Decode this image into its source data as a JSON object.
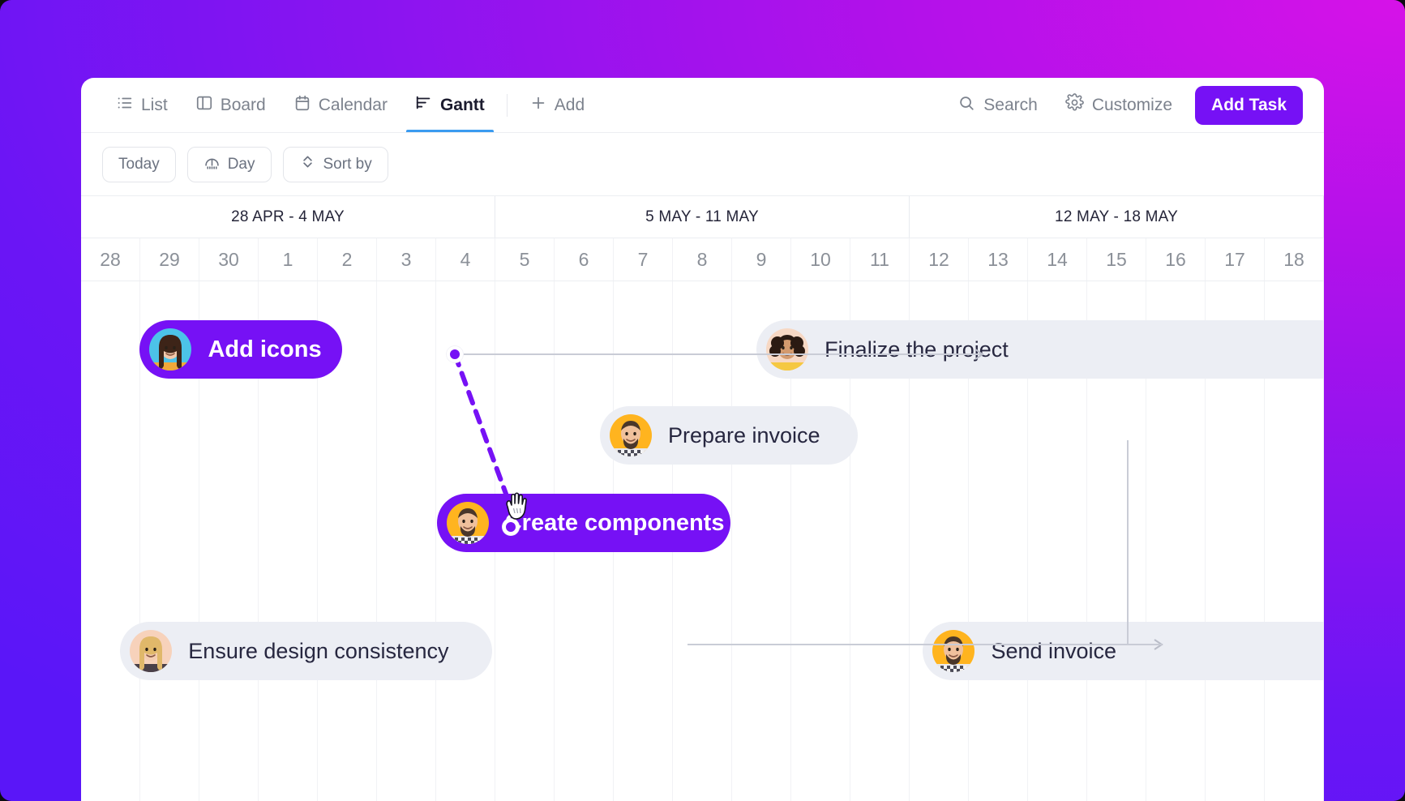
{
  "app": {
    "accent_purple": "#7611f5",
    "accent_blue": "#3b9bf0",
    "bar_ghost_bg": "#eceef4"
  },
  "viewbar": {
    "tabs": [
      {
        "id": "list",
        "label": "List",
        "icon": "list-icon",
        "active": false
      },
      {
        "id": "board",
        "label": "Board",
        "icon": "board-icon",
        "active": false
      },
      {
        "id": "calendar",
        "label": "Calendar",
        "icon": "calendar-icon",
        "active": false
      },
      {
        "id": "gantt",
        "label": "Gantt",
        "icon": "gantt-icon",
        "active": true
      }
    ],
    "add_label": "Add",
    "add_icon": "plus-icon",
    "search_label": "Search",
    "search_icon": "search-icon",
    "customize_label": "Customize",
    "customize_icon": "gear-icon",
    "add_task_label": "Add Task"
  },
  "filterbar": {
    "today_label": "Today",
    "zoom_label": "Day",
    "zoom_icon": "timeline-icon",
    "sort_label": "Sort by",
    "sort_icon": "sort-updown-icon"
  },
  "timeline": {
    "weeks": [
      {
        "label": "28 APR - 4 MAY",
        "days": 7
      },
      {
        "label": "5 MAY - 11 MAY",
        "days": 7
      },
      {
        "label": "12 MAY - 18 MAY",
        "days": 7
      }
    ],
    "days": [
      "28",
      "29",
      "30",
      "1",
      "2",
      "3",
      "4",
      "5",
      "6",
      "7",
      "8",
      "9",
      "10",
      "11",
      "12",
      "13",
      "14",
      "15",
      "16",
      "17",
      "18"
    ]
  },
  "tasks": [
    {
      "id": "add-icons",
      "title": "Add icons",
      "style": "filled",
      "avatar": "avatar-woman-brunette",
      "row": 0,
      "start_col": 1.9,
      "end_col": 5.0,
      "has_dot_right": true
    },
    {
      "id": "finalize-the-project",
      "title": "Finalize the project",
      "style": "ghost",
      "avatar": "avatar-woman-curly",
      "row": 0,
      "start_col": 11.35,
      "end_col": 21.0,
      "has_dot_right": false
    },
    {
      "id": "prepare-invoice",
      "title": "Prepare invoice",
      "style": "ghost",
      "avatar": "avatar-man-beard",
      "row": 1,
      "start_col": 8.95,
      "end_col": 12.9,
      "has_dot_right": false
    },
    {
      "id": "create-components",
      "title": "Create components",
      "style": "filled",
      "avatar": "avatar-man-beard",
      "row": 2,
      "start_col": 6.45,
      "end_col": 10.95,
      "has_dot_left": true
    },
    {
      "id": "ensure-design-consistency",
      "title": "Ensure design consistency",
      "style": "ghost",
      "avatar": "avatar-woman-blonde",
      "row": 3,
      "start_col": 1.6,
      "end_col": 7.3,
      "has_dot_right": false
    },
    {
      "id": "send-invoice",
      "title": "Send invoice",
      "style": "ghost",
      "avatar": "avatar-man-beard",
      "row": 3,
      "start_col": 13.9,
      "end_col": 21.0,
      "has_dot_right": false
    }
  ],
  "cursor": {
    "icon": "grab-hand-cursor"
  }
}
